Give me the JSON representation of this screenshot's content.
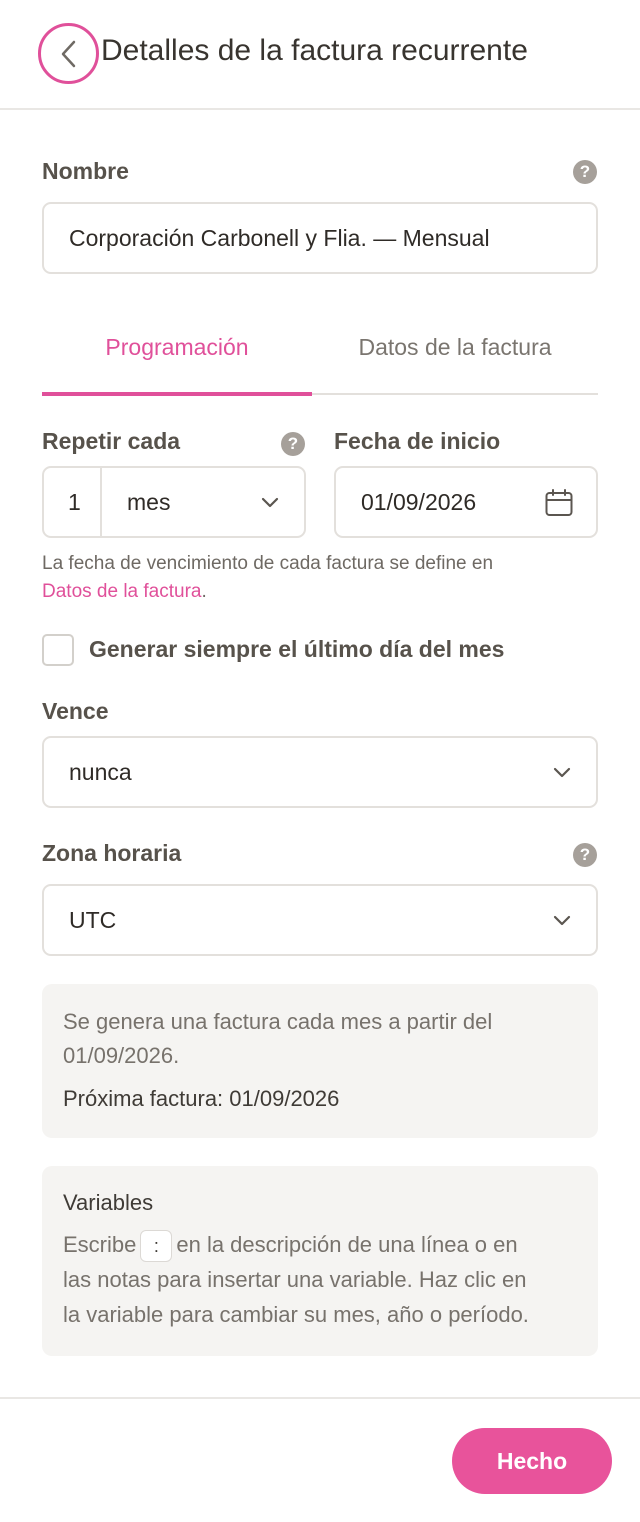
{
  "header": {
    "title": "Detalles de la factura recurrente",
    "back_icon": "chevron-left-icon"
  },
  "name_field": {
    "label": "Nombre",
    "value": "Corporación Carbonell y Flia. — Mensual"
  },
  "tabs": [
    {
      "label": "Programación",
      "active": true
    },
    {
      "label": "Datos de la factura",
      "active": false
    }
  ],
  "repeat": {
    "label": "Repetir cada",
    "count": "1",
    "unit": "mes"
  },
  "start_date": {
    "label": "Fecha de inicio",
    "value": "01/09/2026",
    "icon": "calendar-icon"
  },
  "hint": {
    "text": "La fecha de vencimiento de cada factura se define en",
    "link": "Datos de la factura",
    "suffix": "."
  },
  "last_day": {
    "label": "Generar siempre el último día del mes",
    "checked": false
  },
  "expires": {
    "label": "Vence",
    "value": "nunca"
  },
  "timezone": {
    "label": "Zona horaria",
    "value": "UTC"
  },
  "summary": {
    "line1": "Se genera una factura cada mes a partir del",
    "line2": "01/09/2026.",
    "next": "Próxima factura: 01/09/2026"
  },
  "variables": {
    "title": "Variables",
    "before_key": "Escribe",
    "key": ":",
    "after_key": "en la descripción de una línea o en",
    "line2": "las notas para insertar una variable. Haz clic en",
    "line3": "la variable para cambiar su mes, año o período."
  },
  "footer": {
    "done_label": "Hecho"
  },
  "colors": {
    "accent": "#e0509a",
    "text": "#3f3b36",
    "muted": "#77726c",
    "border": "#e3e0dc",
    "panel": "#f5f4f2"
  }
}
